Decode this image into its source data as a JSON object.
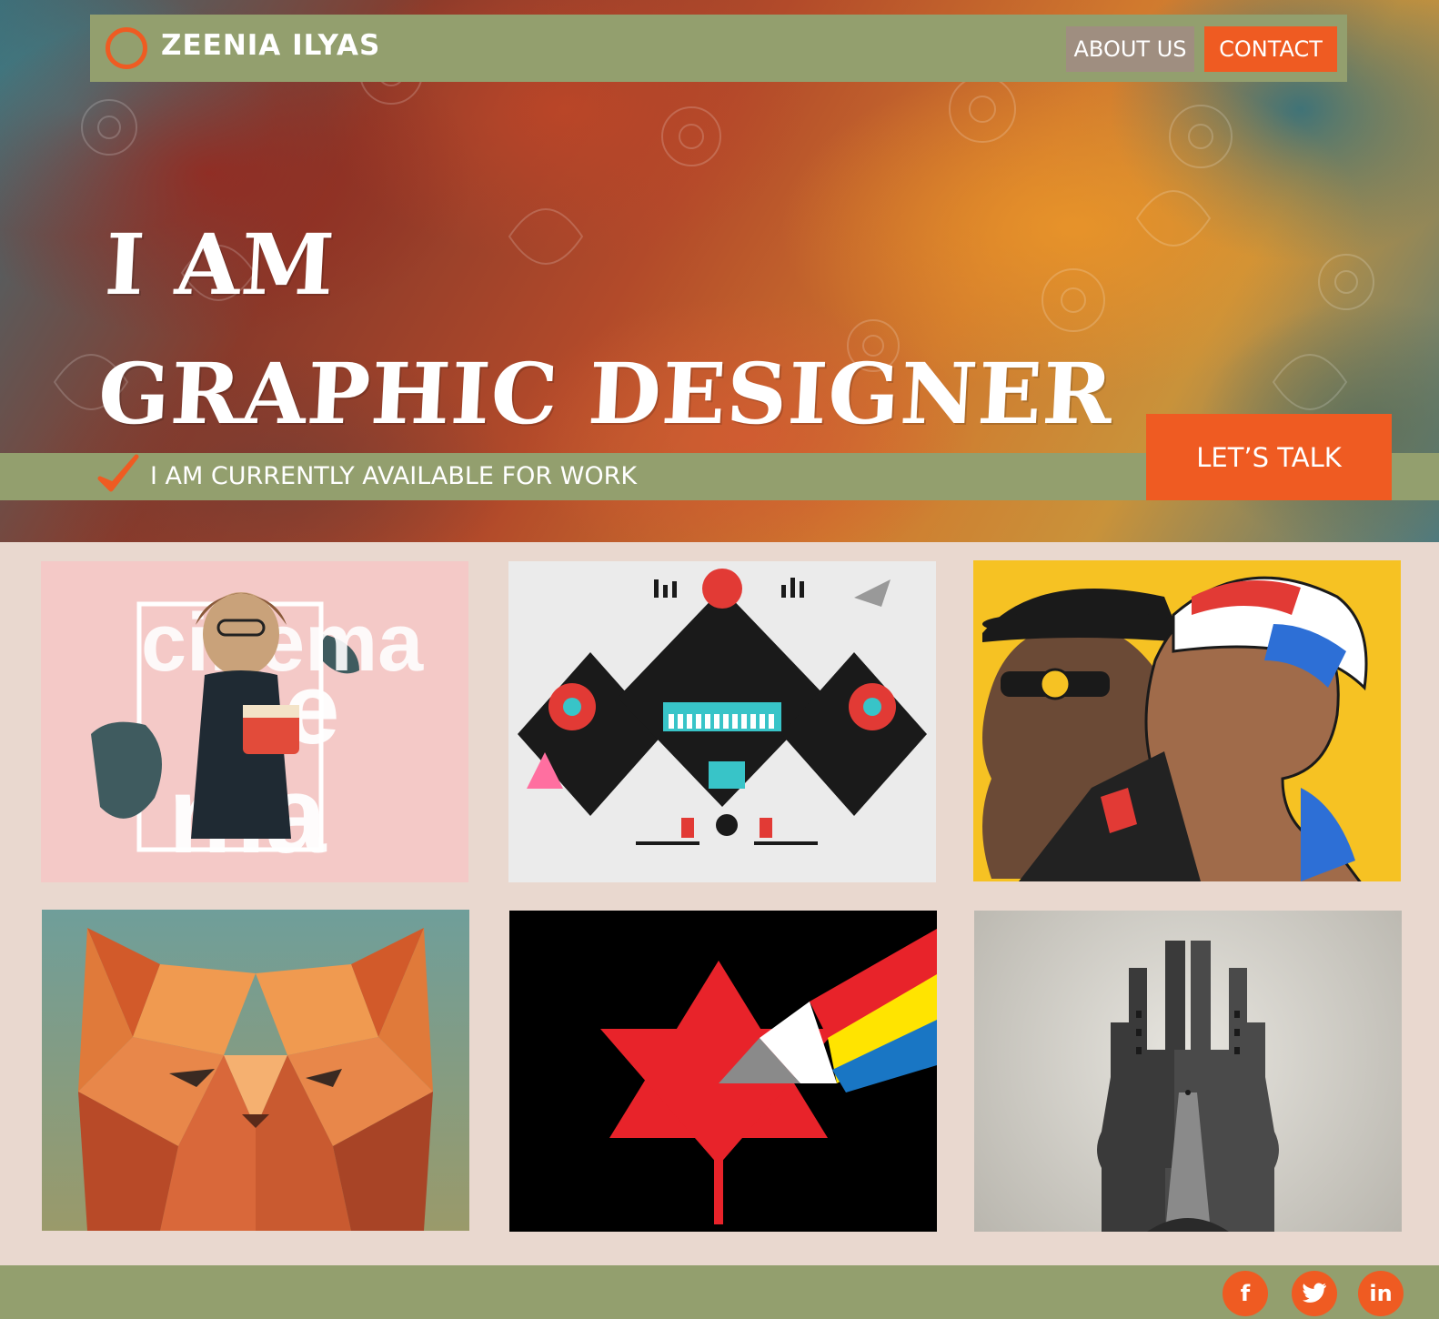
{
  "header": {
    "brand": "ZEENIA ILYAS",
    "nav": {
      "about_label": "ABOUT US",
      "contact_label": "CONTACT"
    }
  },
  "hero": {
    "line1": "I AM",
    "line2": "GRAPHIC DESIGNER",
    "availability": "I AM CURRENTLY AVAILABLE FOR WORK",
    "cta_label": "LET’S TALK"
  },
  "gallery": {
    "items": [
      {
        "icon": "cinema-artwork",
        "text": "cinema"
      },
      {
        "icon": "music-instruments-artwork"
      },
      {
        "icon": "pop-art-portraits-artwork"
      },
      {
        "icon": "low-poly-cat-artwork"
      },
      {
        "icon": "prism-triangle-artwork"
      },
      {
        "icon": "city-head-double-exposure-artwork"
      }
    ]
  },
  "footer": {
    "social": [
      {
        "icon": "facebook-icon",
        "glyph": "f"
      },
      {
        "icon": "twitter-icon",
        "glyph": "t"
      },
      {
        "icon": "linkedin-icon",
        "glyph": "in"
      }
    ]
  },
  "colors": {
    "accent": "#ef5b22",
    "bar_green": "#939f6e",
    "page_bg": "#e9d8cf",
    "about_bg": "#9f8e80"
  }
}
